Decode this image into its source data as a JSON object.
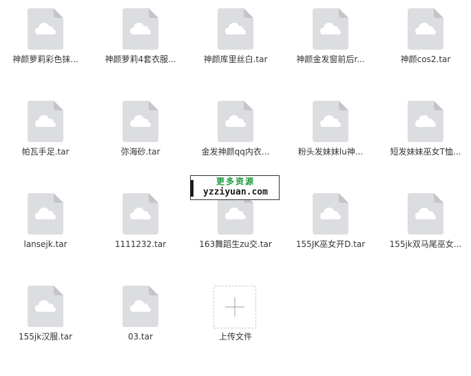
{
  "files": [
    {
      "name": "神颜萝莉彩色抹...",
      "icon": "cloud-file-icon"
    },
    {
      "name": "神颜萝莉4套衣服...",
      "icon": "cloud-file-icon"
    },
    {
      "name": "神颜库里丝白.tar",
      "icon": "cloud-file-icon"
    },
    {
      "name": "神颜金发窗前后r...",
      "icon": "cloud-file-icon"
    },
    {
      "name": "神颜cos2.tar",
      "icon": "cloud-file-icon"
    },
    {
      "name": "帕瓦手足.tar",
      "icon": "cloud-file-icon"
    },
    {
      "name": "弥海砂.tar",
      "icon": "cloud-file-icon"
    },
    {
      "name": "金发神颜qq内衣...",
      "icon": "cloud-file-icon"
    },
    {
      "name": "粉头发妹妹lu神...",
      "icon": "cloud-file-icon"
    },
    {
      "name": "短发妹妹巫女T恤...",
      "icon": "cloud-file-icon"
    },
    {
      "name": "lansejk.tar",
      "icon": "cloud-file-icon"
    },
    {
      "name": "1111232.tar",
      "icon": "cloud-file-icon"
    },
    {
      "name": "163舞蹈生zu交.tar",
      "icon": "cloud-file-icon"
    },
    {
      "name": "155JK巫女开D.tar",
      "icon": "cloud-file-icon"
    },
    {
      "name": "155jk双马尾巫女...",
      "icon": "cloud-file-icon"
    },
    {
      "name": "155jk汉服.tar",
      "icon": "cloud-file-icon"
    },
    {
      "name": "03.tar",
      "icon": "cloud-file-icon"
    }
  ],
  "upload": {
    "label": "上传文件",
    "icon": "plus-icon"
  },
  "watermark": {
    "line1": "更多资源",
    "line2": "yzziyuan.com"
  },
  "colors": {
    "file_icon_bg": "#dcdde0",
    "cloud": "#ffffff",
    "text": "#333333",
    "watermark_green": "#1e9b3c"
  }
}
